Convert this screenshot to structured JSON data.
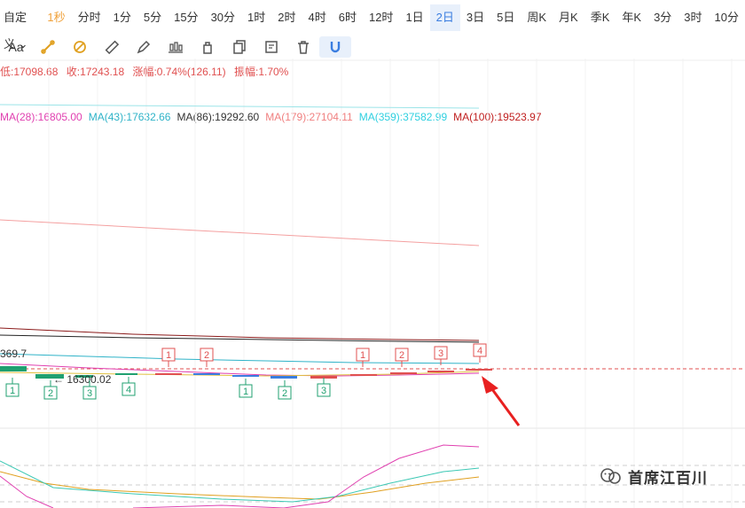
{
  "timeframes": {
    "custom": "自定义",
    "items": [
      "1秒",
      "分时",
      "1分",
      "5分",
      "15分",
      "30分",
      "1时",
      "2时",
      "4时",
      "6时",
      "12时",
      "1日",
      "2日",
      "3日",
      "5日",
      "周K",
      "月K",
      "季K",
      "年K",
      "3分",
      "3时",
      "10分"
    ],
    "active": "2日",
    "highlight": "1秒"
  },
  "toolbar": {
    "text_tool": "Aa",
    "tools": [
      "line-tool-icon",
      "ray-tool-icon",
      "ruler-icon",
      "pen-icon",
      "candle-icon",
      "lock-icon",
      "copy-icon",
      "note-icon",
      "delete-icon",
      "magnet-icon"
    ]
  },
  "info": {
    "low": "低:17098.68",
    "close": "收:17243.18",
    "change": "涨幅:0.74%(126.11)",
    "amplitude": "振幅:1.70%"
  },
  "ma_lines": [
    {
      "label": "MA(28):16805.00",
      "color": "#e040b0"
    },
    {
      "label": "MA(43):17632.66",
      "color": "#2fb3c8"
    },
    {
      "label": "MA(86):19292.60",
      "color": "#333333"
    },
    {
      "label": "MA(179):27104.11",
      "color": "#f08080"
    },
    {
      "label": "MA(359):37582.99",
      "color": "#30d0e0"
    },
    {
      "label": "MA(100):19523.97",
      "color": "#c02020"
    }
  ],
  "price_labels": {
    "high_mark": "369.7",
    "low_mark": "← 16300.02"
  },
  "markers": {
    "up": [
      "1",
      "2",
      "1",
      "2",
      "3",
      "4"
    ],
    "down": [
      "1",
      "2",
      "3",
      "4",
      "1",
      "2",
      "3"
    ]
  },
  "colors": {
    "up_marker": "#e05050",
    "down_marker": "#20a070",
    "active_tf": "#3b7ee0"
  },
  "watermark": "首席江百川"
}
